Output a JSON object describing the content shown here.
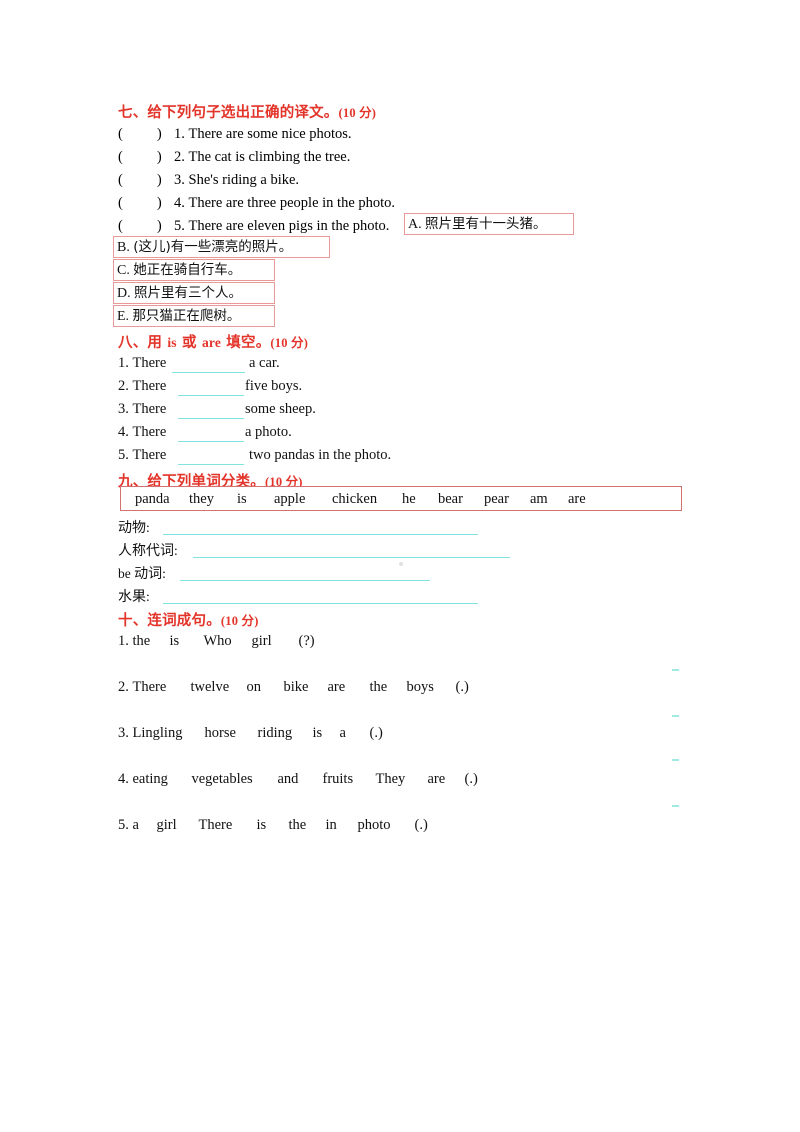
{
  "page": {
    "background": "#ffffff",
    "heading_color": "#e3342a",
    "blank_color": "#7fe3e0",
    "box_border_color": "#e79a98",
    "wordbank_border_color": "#d4706d"
  },
  "section7": {
    "heading_cn": "七、给下列句子选出正确的译文。",
    "heading_points": "(10 分)",
    "questions": [
      {
        "open": "(",
        "close": ")",
        "num": "1.",
        "text": "There are some nice photos."
      },
      {
        "open": "(",
        "close": ")",
        "num": "2.",
        "text": "The cat is climbing the tree."
      },
      {
        "open": "(",
        "close": ")",
        "num": "3.",
        "text": "She's riding a bike."
      },
      {
        "open": "(",
        "close": ")",
        "num": "4.",
        "text": "There are three people in the photo."
      },
      {
        "open": "(",
        "close": ")",
        "num": "5.",
        "text": "There are eleven pigs in the photo."
      }
    ],
    "options": [
      {
        "letter": "A.",
        "text": "照片里有十一头猪。"
      },
      {
        "letter": "B.",
        "text": "(这儿)有一些漂亮的照片。"
      },
      {
        "letter": "C.",
        "text": "她正在骑自行车。"
      },
      {
        "letter": "D.",
        "text": "照片里有三个人。"
      },
      {
        "letter": "E.",
        "text": "那只猫正在爬树。"
      }
    ]
  },
  "section8": {
    "heading_cn_1": "八、用 ",
    "heading_en_1": "is",
    "heading_cn_2": " 或 ",
    "heading_en_2": "are",
    "heading_cn_3": " 填空。",
    "heading_points": "(10 分)",
    "questions": [
      {
        "num": "1.",
        "pre": "There",
        "post": "a car."
      },
      {
        "num": "2.",
        "pre": "There",
        "post": "five boys."
      },
      {
        "num": "3.",
        "pre": "There",
        "post": "some sheep."
      },
      {
        "num": "4.",
        "pre": "There",
        "post": "a photo."
      },
      {
        "num": "5.",
        "pre": "There",
        "post": "two pandas in the photo."
      }
    ]
  },
  "section9": {
    "heading_cn": "九、给下列单词分类。",
    "heading_points": "(10 分)",
    "word_bank": [
      "panda",
      "they",
      "is",
      "apple",
      "chicken",
      "he",
      "bear",
      "pear",
      "am",
      "are"
    ],
    "categories": [
      {
        "label_cn": "动物",
        "label_en": "",
        "colon": ":"
      },
      {
        "label_cn": "人称代词",
        "label_en": "",
        "colon": ":"
      },
      {
        "label_cn": "动词",
        "label_en": "be ",
        "colon": ":"
      },
      {
        "label_cn": "水果",
        "label_en": "",
        "colon": ":"
      }
    ]
  },
  "section10": {
    "heading_cn": "十、连词成句。",
    "heading_points": "(10 分)",
    "questions": [
      {
        "num": "1.",
        "tokens": [
          "the",
          "is",
          "Who",
          "girl",
          "(?)"
        ]
      },
      {
        "num": "2.",
        "tokens": [
          "There",
          "twelve",
          "on",
          "bike",
          "are",
          "the",
          "boys",
          "(.)"
        ]
      },
      {
        "num": "3.",
        "tokens": [
          "Lingling",
          "horse",
          "riding",
          "is",
          "a",
          "(.)"
        ]
      },
      {
        "num": "4.",
        "tokens": [
          "eating",
          "vegetables",
          "and",
          "fruits",
          "They",
          "are",
          "(.)"
        ]
      },
      {
        "num": "5.",
        "tokens": [
          "a",
          "girl",
          "There",
          "is",
          "the",
          "in",
          "photo",
          "(.)"
        ]
      }
    ]
  }
}
